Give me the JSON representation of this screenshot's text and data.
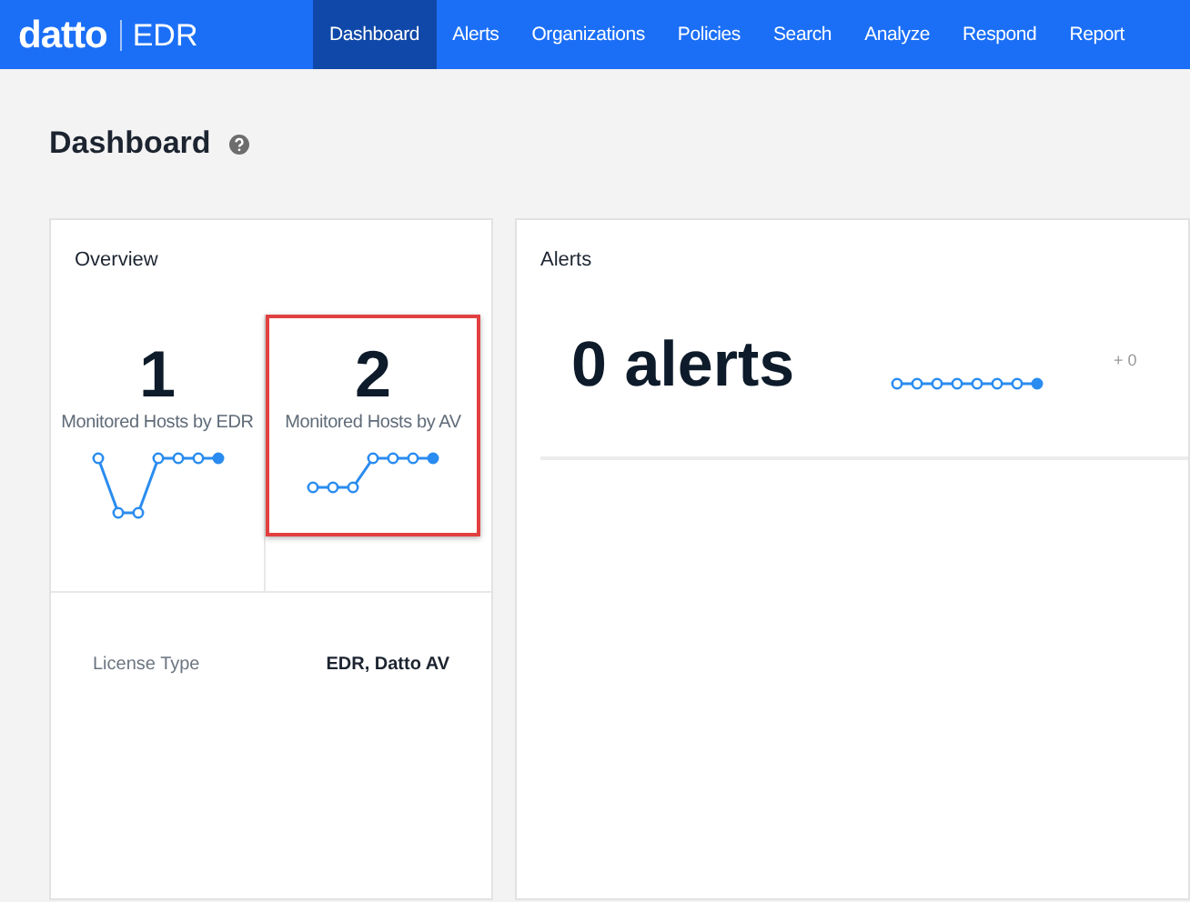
{
  "brand": {
    "logo": "datto",
    "product": "EDR"
  },
  "nav": [
    {
      "label": "Dashboard",
      "selected": true
    },
    {
      "label": "Alerts",
      "selected": false
    },
    {
      "label": "Organizations",
      "selected": false
    },
    {
      "label": "Policies",
      "selected": false
    },
    {
      "label": "Search",
      "selected": false
    },
    {
      "label": "Analyze",
      "selected": false
    },
    {
      "label": "Respond",
      "selected": false
    },
    {
      "label": "Report",
      "selected": false
    }
  ],
  "page_title": "Dashboard",
  "overview": {
    "title": "Overview",
    "stats": [
      {
        "value": "1",
        "label": "Monitored Hosts by EDR",
        "highlighted": false
      },
      {
        "value": "2",
        "label": "Monitored Hosts by AV",
        "highlighted": true
      }
    ],
    "license": {
      "label": "License Type",
      "value": "EDR, Datto AV"
    }
  },
  "alerts": {
    "title": "Alerts",
    "count": "0 alerts",
    "change": "+ 0"
  }
}
